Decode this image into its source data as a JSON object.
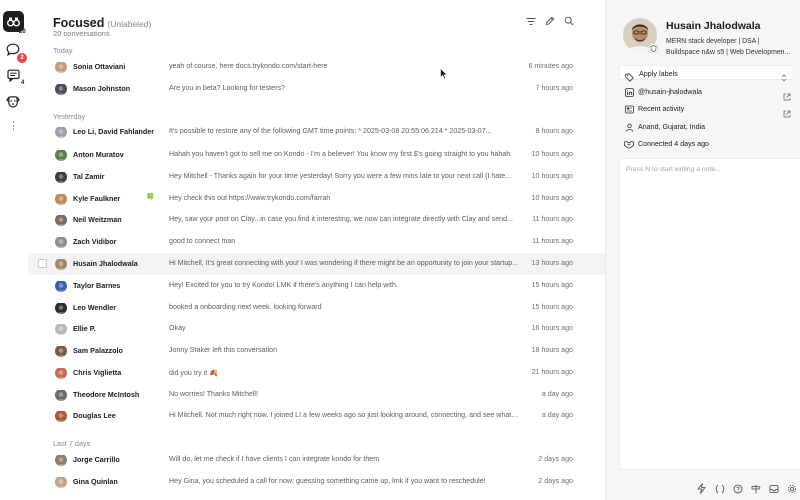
{
  "rail": {
    "items": [
      {
        "icon": "binoculars-icon",
        "count": "20"
      },
      {
        "icon": "chat-bubble-icon",
        "badge": "2"
      },
      {
        "icon": "message-square-icon",
        "count": "4"
      },
      {
        "icon": "dog-icon"
      }
    ]
  },
  "header": {
    "title": "Focused",
    "subtitle": "(Unlabeled)",
    "count": "20 conversations"
  },
  "sections": {
    "today": "Today",
    "yesterday": "Yesterday",
    "last7": "Last 7 days"
  },
  "conversations": [
    {
      "name": "Sonia Ottaviani",
      "message": "yeah of course, here docs.trykondo.com/start-here",
      "time": "6 minutes ago",
      "avatar": "#c89b7b"
    },
    {
      "name": "Mason Johnston",
      "message": "Are you in beta? Looking for testers?",
      "time": "7 hours ago",
      "avatar": "#4a4f5a"
    },
    {
      "name": "Leo Li, David Fahlander",
      "message": "It's possible to restore any of the following GMT time points: * 2025-03-08 20:55:06.214 * 2025-03-07...",
      "time": "8 hours ago",
      "avatar": "#9aa0a8"
    },
    {
      "name": "Anton Muratov",
      "message": "Hahah you haven't got to sell me on Kondo - I'm a believer! You know my first $'s going straight to you hahah",
      "time": "10 hours ago",
      "avatar": "#5e7d52"
    },
    {
      "name": "Tal Zamir",
      "message": "Hey Mitchell - Thanks again for your time yesterday! Sorry you were a few mins late to your next call (I hate...",
      "time": "10 hours ago",
      "avatar": "#3c3c3c"
    },
    {
      "name": "Kyle Faulkner",
      "message": "Hey check this out https://www.trykondo.com/farrah",
      "time": "10 hours ago",
      "avatar": "#b88a5e",
      "emoji": "🍀"
    },
    {
      "name": "Neil Weitzman",
      "message": "Hey, saw your post on Clay...in case you find it interesting, we now can integrate directly with Clay and send...",
      "time": "11 hours ago",
      "avatar": "#7b6a5d"
    },
    {
      "name": "Zach Vidibor",
      "message": "good to connect man",
      "time": "11 hours ago",
      "avatar": "#8d8d8d"
    },
    {
      "name": "Husain Jhalodwala",
      "message": "Hi Mitchell, It's great connecting with you! I was wondering if there might be an opportunity to join your startup...",
      "time": "13 hours ago",
      "avatar": "#a48a6c"
    },
    {
      "name": "Taylor Barnes",
      "message": "Hey! Excited for you to try Kondo! LMK if there's anything I can help with.",
      "time": "15 hours ago",
      "avatar": "#3b5fa8"
    },
    {
      "name": "Leo Wendler",
      "message": "booked a onboarding next week. looking forward",
      "time": "15 hours ago",
      "avatar": "#2d2d2d"
    },
    {
      "name": "Ellie P.",
      "message": "Okay",
      "time": "16 hours ago",
      "avatar": "#b7b7b7"
    },
    {
      "name": "Sam Palazzolo",
      "message": "Jonny Staker left this conversation",
      "time": "18 hours ago",
      "avatar": "#7a5a44"
    },
    {
      "name": "Chris Viglietta",
      "message": "did you try it 🍂",
      "time": "21 hours ago",
      "avatar": "#c46b5a"
    },
    {
      "name": "Theodore McIntosh",
      "message": "No worries! Thanks Mitchell!",
      "time": "a day ago",
      "avatar": "#6b6b6b"
    },
    {
      "name": "Douglas Lee",
      "message": "Hi Mitchell. Not much right now. I joined LI a few weeks ago so just looking around, connecting, and see what L...",
      "time": "a day ago",
      "avatar": "#a65a3c"
    },
    {
      "name": "Jorge Carrillo",
      "message": "Will do, let me check if I have clients I can integrate kondo for them",
      "time": "2 days ago",
      "avatar": "#8a7d6e"
    },
    {
      "name": "Gina Quinlan",
      "message": "Hey Gina, you scheduled a call for now; guessing something came up, lmk if you want to reschedule!",
      "time": "2 days ago",
      "avatar": "#c4a38a"
    }
  ],
  "profile": {
    "name": "Husain Jhalodwala",
    "headline": "MERN stack developer | DSA | Buildspace n&w s5 | Web Developmen...",
    "apply_labels": "Apply labels",
    "handle": "@husain-jhalodwala",
    "recent_activity": "Recent activity",
    "location": "Anand, Gujarat, India",
    "connected": "Connected 4 days ago",
    "note_placeholder": "Press N to start writing a note..."
  },
  "colors": {
    "accent_dark": "#1f1f1f",
    "badge_red": "#e5484d",
    "highlight_row": "#f3f3f3"
  }
}
